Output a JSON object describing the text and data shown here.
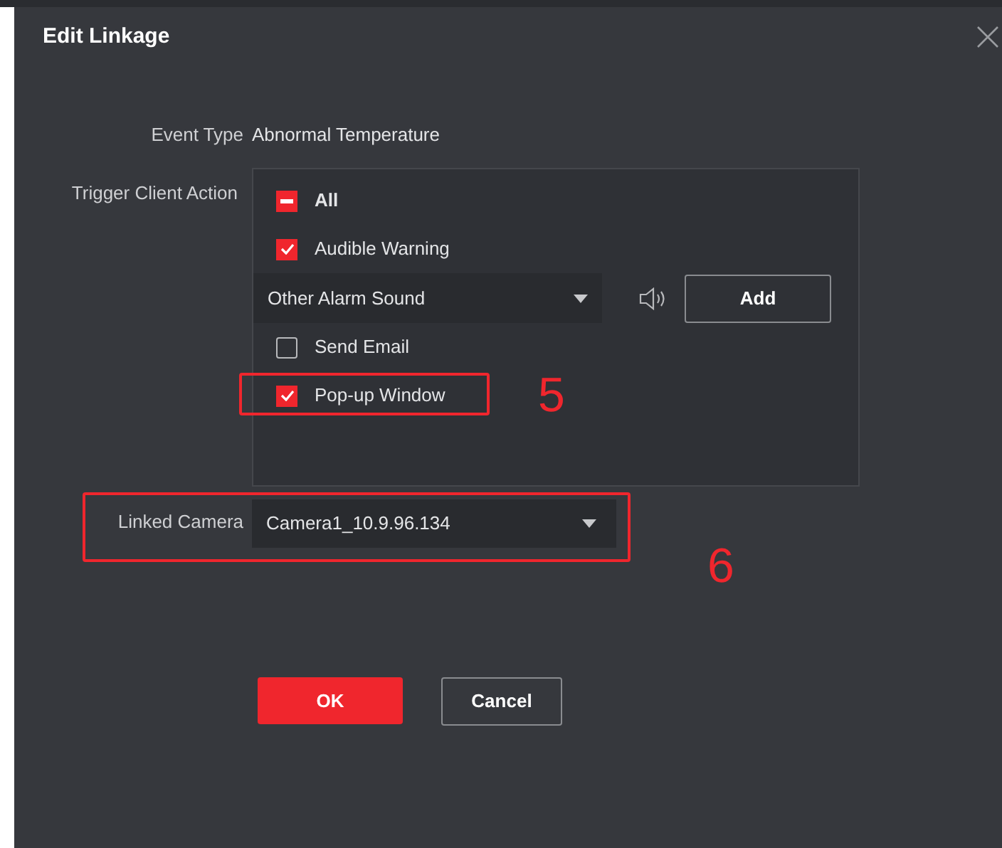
{
  "dialog": {
    "title": "Edit Linkage"
  },
  "event_type": {
    "label": "Event Type",
    "value": "Abnormal Temperature"
  },
  "trigger": {
    "label": "Trigger Client Action",
    "items": [
      {
        "kind": "checkbox",
        "label": "All",
        "checked": true,
        "partial": true,
        "bold": true
      },
      {
        "kind": "checkbox",
        "label": "Audible Warning",
        "checked": true
      },
      {
        "kind": "sound-select",
        "value": "Other Alarm Sound",
        "button": "Add"
      },
      {
        "kind": "checkbox",
        "label": "Send Email",
        "checked": false
      },
      {
        "kind": "checkbox",
        "label": "Pop-up Window",
        "checked": true,
        "annotation": "5"
      }
    ]
  },
  "linked_camera": {
    "label": "Linked Camera",
    "value": "Camera1_10.9.96.134",
    "annotation": "6"
  },
  "buttons": [
    {
      "kind": "primary",
      "label": "OK"
    },
    {
      "kind": "secondary",
      "label": "Cancel"
    }
  ]
}
